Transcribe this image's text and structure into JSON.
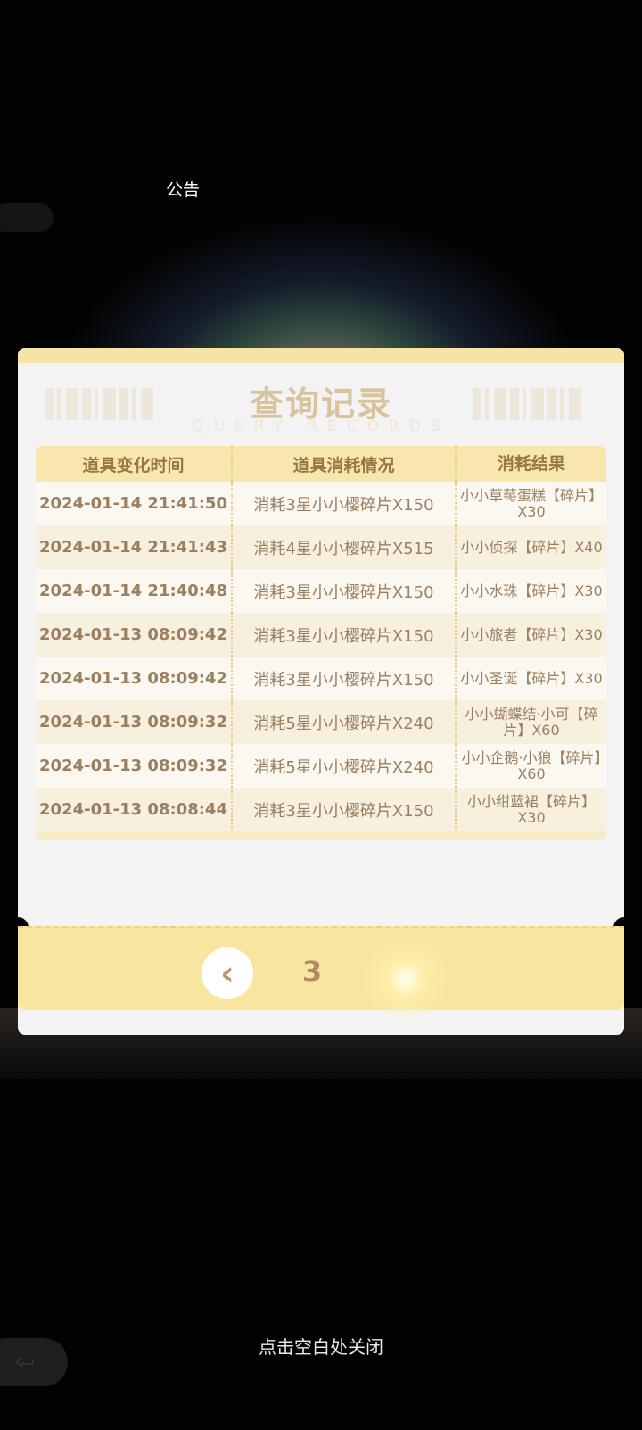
{
  "background": {
    "notice_label": "公告"
  },
  "panel": {
    "title": "查询记录",
    "subtitle": "QUERY RECORDS",
    "columns": [
      "道具变化时间",
      "道具消耗情况",
      "消耗结果"
    ],
    "rows": [
      {
        "time": "2024-01-14 21:41:50",
        "consumption": "消耗3星小小樱碎片X150",
        "result": "小小草莓蛋糕【碎片】X30"
      },
      {
        "time": "2024-01-14 21:41:43",
        "consumption": "消耗4星小小樱碎片X515",
        "result": "小小侦探【碎片】X40"
      },
      {
        "time": "2024-01-14 21:40:48",
        "consumption": "消耗3星小小樱碎片X150",
        "result": "小小水珠【碎片】X30"
      },
      {
        "time": "2024-01-13 08:09:42",
        "consumption": "消耗3星小小樱碎片X150",
        "result": "小小旅者【碎片】X30"
      },
      {
        "time": "2024-01-13 08:09:42",
        "consumption": "消耗3星小小樱碎片X150",
        "result": "小小圣诞【碎片】X30"
      },
      {
        "time": "2024-01-13 08:09:32",
        "consumption": "消耗5星小小樱碎片X240",
        "result": "小小蝴蝶结·小可【碎片】X60"
      },
      {
        "time": "2024-01-13 08:09:32",
        "consumption": "消耗5星小小樱碎片X240",
        "result": "小小企鹅·小狼【碎片】X60"
      },
      {
        "time": "2024-01-13 08:08:44",
        "consumption": "消耗3星小小樱碎片X150",
        "result": "小小绀蓝裙【碎片】X30"
      }
    ],
    "pagination": {
      "prev_icon": "chevron-left-icon",
      "current_page": "3"
    }
  },
  "close_hint": "点击空白处关闭",
  "colors": {
    "accent": "#f8e6a0",
    "title": "#d8c39c",
    "text": "#9a7f60"
  }
}
